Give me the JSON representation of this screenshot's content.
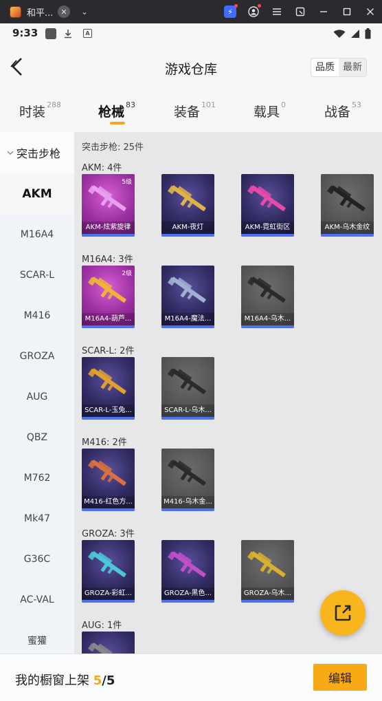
{
  "window": {
    "tab_title": "和平...",
    "close_glyph": "✕",
    "dropdown_glyph": "⌄"
  },
  "status": {
    "time": "9:33"
  },
  "nav": {
    "title": "游戏仓库",
    "sort_options": [
      "品质",
      "最新"
    ]
  },
  "categories": [
    {
      "label": "时装",
      "count": "288"
    },
    {
      "label": "枪械",
      "count": "83"
    },
    {
      "label": "装备",
      "count": "101"
    },
    {
      "label": "载具",
      "count": "0"
    },
    {
      "label": "战备",
      "count": "53"
    }
  ],
  "active_category": "枪械",
  "sidebar": {
    "group": "突击步枪",
    "items": [
      "AKM",
      "M16A4",
      "SCAR-L",
      "M416",
      "GROZA",
      "AUG",
      "QBZ",
      "M762",
      "Mk47",
      "G36C",
      "AC-VAL",
      "蜜獾"
    ],
    "active": "AKM"
  },
  "content": {
    "summary": "突击步枪: 25件",
    "sections": [
      {
        "label": "AKM: 4件",
        "cards": [
          {
            "name": "AKM-炫紫旋律",
            "level": "5级",
            "tier": "pink",
            "weapon_color": "#e8a0ee"
          },
          {
            "name": "AKM-夜灯",
            "level": "",
            "tier": "purple",
            "weapon_color": "#e0b24a"
          },
          {
            "name": "AKM-霓虹街区",
            "level": "",
            "tier": "purple",
            "weapon_color": "#e84aa8"
          },
          {
            "name": "AKM-乌木金纹",
            "level": "",
            "tier": "grey",
            "weapon_color": "#222222"
          }
        ]
      },
      {
        "label": "M16A4: 3件",
        "cards": [
          {
            "name": "M16A4-葫芦...",
            "level": "2级",
            "tier": "pink",
            "weapon_color": "#f0b23a"
          },
          {
            "name": "M16A4-魔法...",
            "level": "",
            "tier": "purple",
            "weapon_color": "#9fb0d0"
          },
          {
            "name": "M16A4-乌木...",
            "level": "",
            "tier": "grey",
            "weapon_color": "#2a2a2a"
          }
        ]
      },
      {
        "label": "SCAR-L: 2件",
        "cards": [
          {
            "name": "SCAR-L-玉兔...",
            "level": "",
            "tier": "purple",
            "weapon_color": "#e0a030"
          },
          {
            "name": "SCAR-L-乌木...",
            "level": "",
            "tier": "grey",
            "weapon_color": "#2a2a2a"
          }
        ]
      },
      {
        "label": "M416: 2件",
        "cards": [
          {
            "name": "M416-红色方...",
            "level": "",
            "tier": "purple",
            "weapon_color": "#d87040"
          },
          {
            "name": "M416-乌木金...",
            "level": "",
            "tier": "grey",
            "weapon_color": "#2a2a2a"
          }
        ]
      },
      {
        "label": "GROZA: 3件",
        "cards": [
          {
            "name": "GROZA-彩虹...",
            "level": "",
            "tier": "purple",
            "weapon_color": "#4ac8d8"
          },
          {
            "name": "GROZA-黑色...",
            "level": "",
            "tier": "purple",
            "weapon_color": "#c050c8"
          },
          {
            "name": "GROZA-乌木...",
            "level": "",
            "tier": "grey",
            "weapon_color": "#d8b030"
          }
        ]
      },
      {
        "label": "AUG: 1件",
        "cards": [
          {
            "name": "",
            "level": "",
            "tier": "purple",
            "weapon_color": "#888888"
          }
        ]
      }
    ]
  },
  "bottom": {
    "label": "我的橱窗上架",
    "shown": "5",
    "total": "/5",
    "edit_label": "编辑"
  },
  "colors": {
    "accent": "#f5a623",
    "fab": "#f8b51d",
    "card_bar": "#4d72f0"
  },
  "icons": [
    "back-icon",
    "share-icon",
    "chevron-down-icon",
    "wifi-icon",
    "signal-icon",
    "battery-icon",
    "download-icon"
  ]
}
